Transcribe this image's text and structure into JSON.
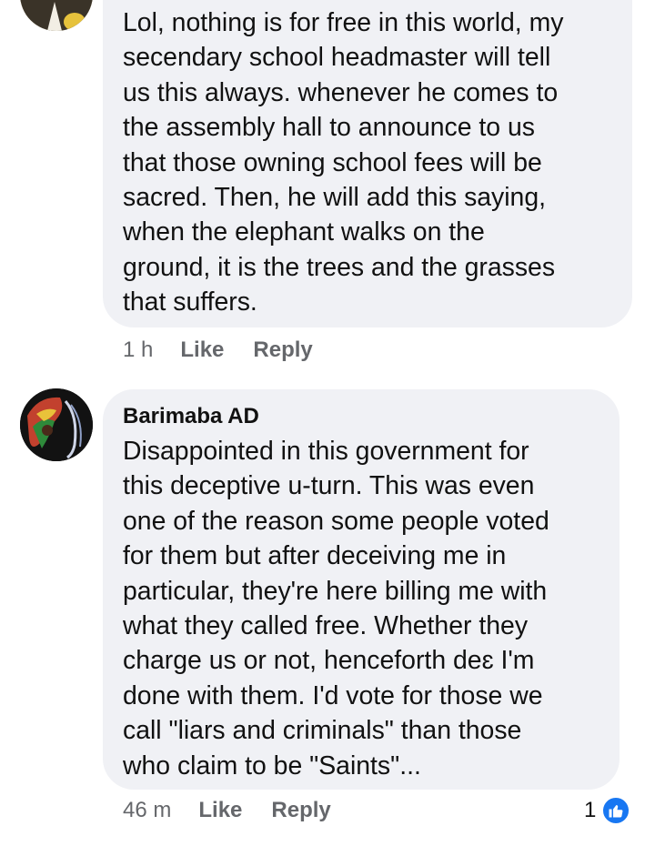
{
  "comments": [
    {
      "author": "",
      "text": "Lol, nothing is for free in this world, my\nsecendary school headmaster will tell\nus this always.  whenever he comes to\nthe assembly hall to  announce to us\nthat those owning school fees will be\nsacred. Then, he will add this saying,\nwhen the elephant walks on the\nground, it is the trees and the grasses\nthat suffers.",
      "time": "1 h",
      "like_label": "Like",
      "reply_label": "Reply"
    },
    {
      "author": "Barimaba AD",
      "text": "Disappointed in this government for\nthis deceptive u-turn. This was even\none of the reason some people voted\nfor them but after deceiving me in\nparticular, they're here billing me with\nwhat they called free. Whether they\ncharge us or not, henceforth deɛ I'm\ndone with them. I'd vote for those we\ncall \"liars and criminals\" than those\nwho claim to be \"Saints\"...",
      "time": "46 m",
      "like_label": "Like",
      "reply_label": "Reply",
      "reaction_count": "1",
      "reaction_icon": "thumbs-up-icon"
    }
  ],
  "colors": {
    "bubble": "#f0f1f5",
    "meta_text": "#65676b",
    "like_blue": "#1877f2"
  }
}
